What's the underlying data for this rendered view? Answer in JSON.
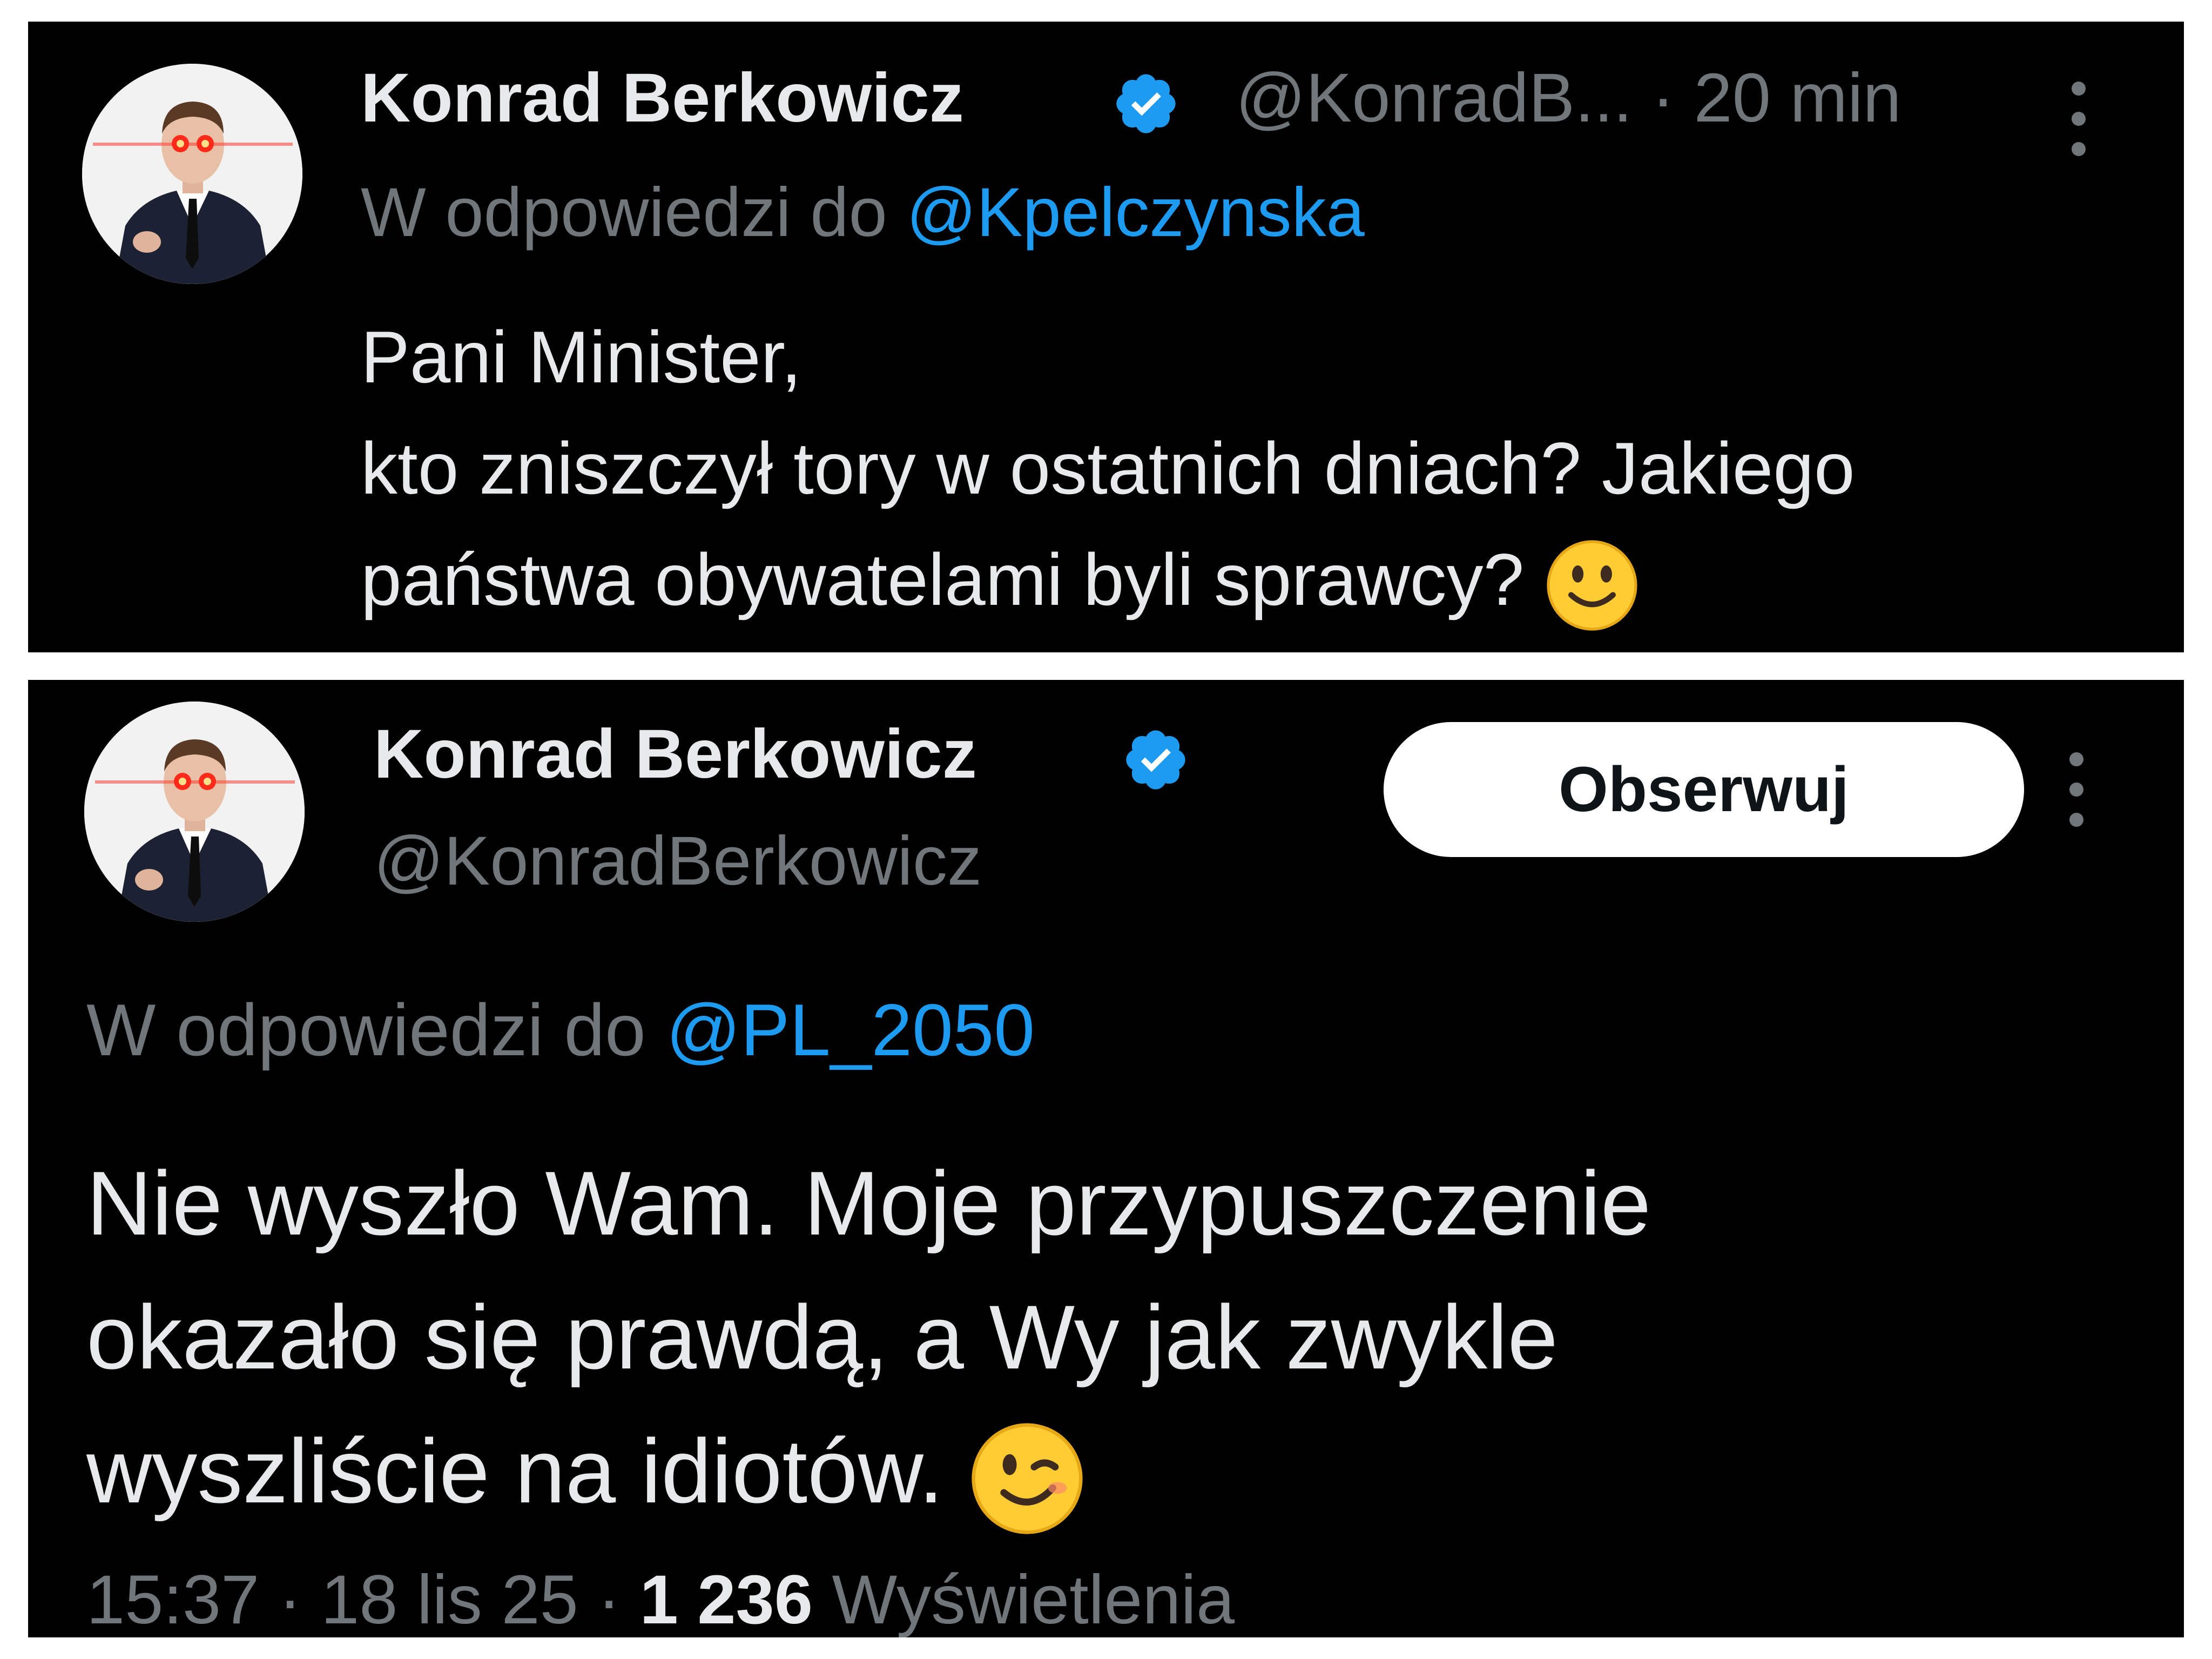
{
  "colors": {
    "background": "#000000",
    "text_primary": "#e7e9ea",
    "text_secondary": "#71767b",
    "link": "#1d9bf0",
    "verified_badge": "#1d9bf0",
    "follow_button_bg": "#ffffff",
    "follow_button_text": "#0f1419"
  },
  "tweet_1": {
    "avatar_icon": "profile-photo-icon",
    "author_name": "Konrad Berkowicz",
    "verified_icon": "verified-badge-icon",
    "handle_truncated": "@KonradB...",
    "time_separator": "·",
    "time_ago": "20 min",
    "more_icon": "more-vertical-icon",
    "reply_prefix": "W odpowiedzi do",
    "reply_to": "@Kpelczynska",
    "text_lines": [
      "Pani Minister,",
      "kto zniszczył tory w ostatnich dniach? Jakiego",
      "państwa obywatelami byli sprawcy?"
    ],
    "emoji_icon": "slightly-smiling-face-icon"
  },
  "tweet_2": {
    "avatar_icon": "profile-photo-icon",
    "author_name": "Konrad Berkowicz",
    "verified_icon": "verified-badge-icon",
    "handle": "@KonradBerkowicz",
    "follow_label": "Obserwuj",
    "more_icon": "more-vertical-icon",
    "reply_prefix": "W odpowiedzi do",
    "reply_to": "@PL_2050",
    "text_lines": [
      "Nie wyszło Wam. Moje przypuszczenie",
      "okazało się prawdą, a Wy jak zwykle",
      "wyszliście na idiotów."
    ],
    "emoji_icon": "winking-face-icon",
    "time": "15:37",
    "separator": "·",
    "date": "18 lis 25",
    "views_count": "1 236",
    "views_label": "Wyświetlenia"
  }
}
